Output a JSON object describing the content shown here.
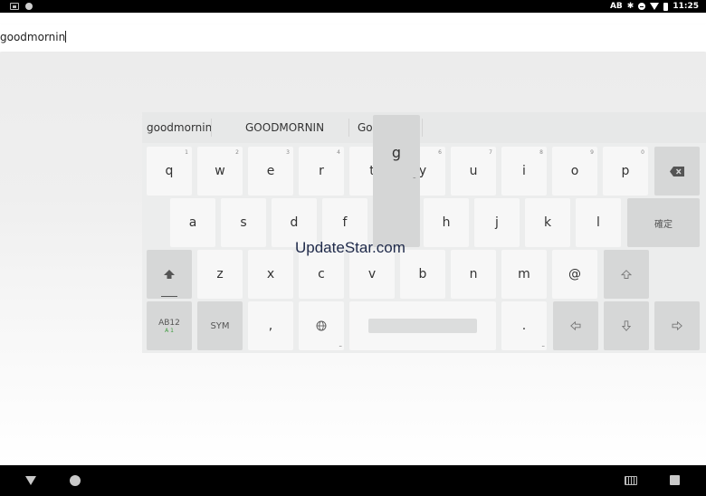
{
  "status_bar": {
    "input_mode": "AB",
    "time": "11:25"
  },
  "text_field": {
    "value": "goodmornin"
  },
  "keyboard": {
    "candidates": [
      "goodmornin",
      "GOODMORNIN",
      "Go"
    ],
    "popup_char": "g",
    "row1": [
      {
        "label": "q",
        "hint": "1"
      },
      {
        "label": "w",
        "hint": "2"
      },
      {
        "label": "e",
        "hint": "3"
      },
      {
        "label": "r",
        "hint": "4"
      },
      {
        "label": "t",
        "hint": "5"
      },
      {
        "label": "y",
        "hint": "6"
      },
      {
        "label": "u",
        "hint": "7"
      },
      {
        "label": "i",
        "hint": "8"
      },
      {
        "label": "o",
        "hint": "9"
      },
      {
        "label": "p",
        "hint": "0"
      }
    ],
    "row2": [
      "a",
      "s",
      "d",
      "f",
      "g",
      "h",
      "j",
      "k",
      "l"
    ],
    "row3": [
      "z",
      "x",
      "c",
      "v",
      "b",
      "n",
      "m",
      "@"
    ],
    "confirm_label": "確定",
    "mode_label": "AB12",
    "mode_sub": "A 1",
    "sym_label": "SYM",
    "comma_label": ",",
    "period_label": ".",
    "icons": {
      "backspace": "backspace-icon",
      "shift": "shift-icon",
      "globe": "globe-icon",
      "left": "arrow-left-icon",
      "down": "arrow-down-icon",
      "right": "arrow-right-icon"
    }
  },
  "watermark": "UpdateStar.com"
}
